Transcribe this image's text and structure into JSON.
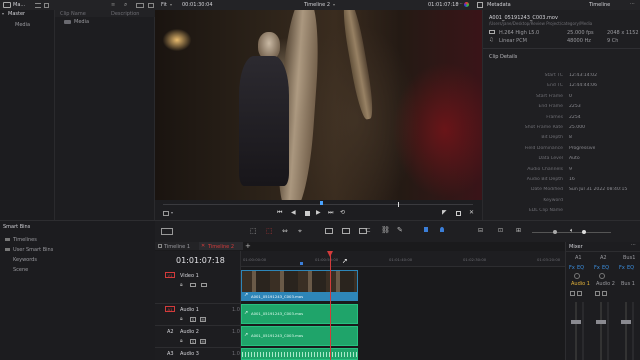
{
  "topbar": {
    "media_pool_label": "Ma...",
    "zoom": "Fit",
    "source_tc": "00:01:30:04",
    "timeline_name": "Timeline 2",
    "timeline_tc": "01:01:07:18",
    "metadata_label": "Metadata",
    "timeline_label": "Timeline"
  },
  "left": {
    "master": "Master",
    "media": "Media",
    "col_clip_name": "Clip Name",
    "col_description": "Description",
    "media_folder": "Media",
    "smart_bins": "Smart Bins",
    "smart_items": [
      "Timelines",
      "User Smart Bins",
      "Keywords",
      "Scene"
    ]
  },
  "metadata": {
    "file_name": "A001_05191243_C003.mov",
    "file_path": "/Users/jane/Desktop/Review Project/category/Media",
    "codec": "H.264 High L5.0",
    "fps": "25.000 fps",
    "resolution": "2048 x 1152",
    "audio_codec": "Linear PCM",
    "sample_rate": "48000 Hz",
    "channels": "9 Ch",
    "section": "Clip Details",
    "rows": [
      {
        "k": "Start TC",
        "v": "12:43:14:02"
      },
      {
        "k": "End TC",
        "v": "12:44:44:06"
      },
      {
        "k": "Start Frame",
        "v": "0"
      },
      {
        "k": "End Frame",
        "v": "2253"
      },
      {
        "k": "Frames",
        "v": "2254"
      },
      {
        "k": "Shot Frame Rate",
        "v": "25.000"
      },
      {
        "k": "Bit Depth",
        "v": "8"
      },
      {
        "k": "Field Dominance",
        "v": "Progressive"
      },
      {
        "k": "Data Level",
        "v": "Auto"
      },
      {
        "k": "Audio Channels",
        "v": "9"
      },
      {
        "k": "Audio Bit Depth",
        "v": "16"
      },
      {
        "k": "Date Modified",
        "v": "Sun Jul 31 2022 08:40:15"
      },
      {
        "k": "Keyword",
        "v": ""
      },
      {
        "k": "EDL Clip Name",
        "v": ""
      }
    ]
  },
  "timeline": {
    "tabs": [
      "Timeline 1",
      "Timeline 2"
    ],
    "timecode": "01:01:07:18",
    "ruler": [
      "01:00:00:00",
      "01:00:50:00",
      "01:01:40:00",
      "01:02:30:00",
      "01:03:20:00",
      "01:04:10:00"
    ],
    "video_track": "Video 1",
    "v1": "V1",
    "a1": "A1",
    "a1_name": "Audio 1",
    "a2": "A2",
    "a2_name": "Audio 2",
    "a3": "A3",
    "a3_name": "Audio 3",
    "clip_name": "A001_05191243_C003.mov",
    "audio_level": "1.0",
    "track_buttons": [
      "S",
      "M"
    ]
  },
  "mixer": {
    "title": "Mixer",
    "channels": [
      "A1",
      "A2",
      "Bus1"
    ],
    "ch_labels": [
      "Audio 1",
      "Audio 2",
      "Bus 1"
    ],
    "fx": "Fx",
    "eq": "EQ",
    "accent": "#e3b33a"
  },
  "colors": {
    "accent_red": "#d33b3b",
    "clip_video": "#2e86b8",
    "clip_audio": "#1fa46a",
    "playhead": "#d33b3b"
  }
}
